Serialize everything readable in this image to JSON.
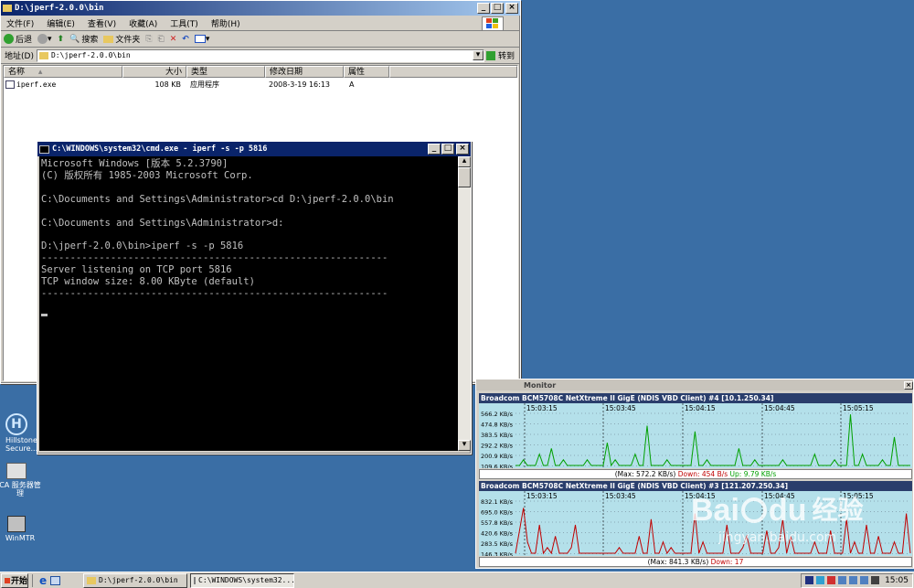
{
  "explorer": {
    "title": "D:\\jperf-2.0.0\\bin",
    "menu": [
      "文件(F)",
      "编辑(E)",
      "查看(V)",
      "收藏(A)",
      "工具(T)",
      "帮助(H)"
    ],
    "toolbar": {
      "back": "后退",
      "search": "搜索",
      "folders": "文件夹"
    },
    "address_label": "地址(D)",
    "address_value": "D:\\jperf-2.0.0\\bin",
    "go": "转到",
    "columns": [
      "名称",
      "大小",
      "类型",
      "修改日期",
      "属性"
    ],
    "files": [
      {
        "name": "iperf.exe",
        "size": "108 KB",
        "type": "应用程序",
        "modified": "2008-3-19 16:13",
        "attr": "A"
      }
    ]
  },
  "cmd": {
    "title": "C:\\WINDOWS\\system32\\cmd.exe - iperf -s -p 5816",
    "lines": [
      "Microsoft Windows [版本 5.2.3790]",
      "(C) 版权所有 1985-2003 Microsoft Corp.",
      "",
      "C:\\Documents and Settings\\Administrator>cd D:\\jperf-2.0.0\\bin",
      "",
      "C:\\Documents and Settings\\Administrator>d:",
      "",
      "D:\\jperf-2.0.0\\bin>iperf -s -p 5816",
      "------------------------------------------------------------",
      "Server listening on TCP port 5816",
      "TCP window size: 8.00 KByte (default)",
      "------------------------------------------------------------",
      ""
    ]
  },
  "desktop": {
    "icons": [
      {
        "label": "Hillstone Secure..."
      },
      {
        "label": "CA 服务器管理"
      },
      {
        "label": "WinMTR"
      }
    ]
  },
  "monitor": {
    "title": "Monitor",
    "panels": [
      {
        "header": "Broadcom BCM5708C NetXtreme II GigE (NDIS VBD Client) #4 [10.1.250.34]",
        "times": [
          "15:03:15",
          "15:03:45",
          "15:04:15",
          "15:04:45",
          "15:05:15"
        ],
        "ylabels": [
          "566.2 KB/s",
          "474.8 KB/s",
          "383.5 KB/s",
          "292.2 KB/s",
          "200.9 KB/s",
          "109.6 KB/s"
        ],
        "stat_max": "(Max: 572.2 KB/s)",
        "stat_down": "Down: 454 B/s",
        "stat_up": "Up: 9.79 KB/s",
        "line_color": "#00a000"
      },
      {
        "header": "Broadcom BCM5708C NetXtreme II GigE (NDIS VBD Client) #3 [121.207.250.34]",
        "times": [
          "15:03:15",
          "15:03:45",
          "15:04:15",
          "15:04:45",
          "15:05:15"
        ],
        "ylabels": [
          "832.1 KB/s",
          "695.0 KB/s",
          "557.8 KB/s",
          "420.6 KB/s",
          "283.5 KB/s",
          "146.3 KB/s"
        ],
        "stat_max": "(Max: 841.3 KB/s)",
        "stat_down": "Down: 17",
        "stat_up": "",
        "line_color": "#c00000"
      }
    ]
  },
  "watermark": {
    "brand": "Bai",
    "brand2": "du",
    "cn": "经验",
    "url": "jingyan.baidu.com"
  },
  "taskbar": {
    "start": "开始",
    "tasks": [
      "D:\\jperf-2.0.0\\bin",
      "C:\\WINDOWS\\system32..."
    ],
    "clock": "15:05"
  }
}
